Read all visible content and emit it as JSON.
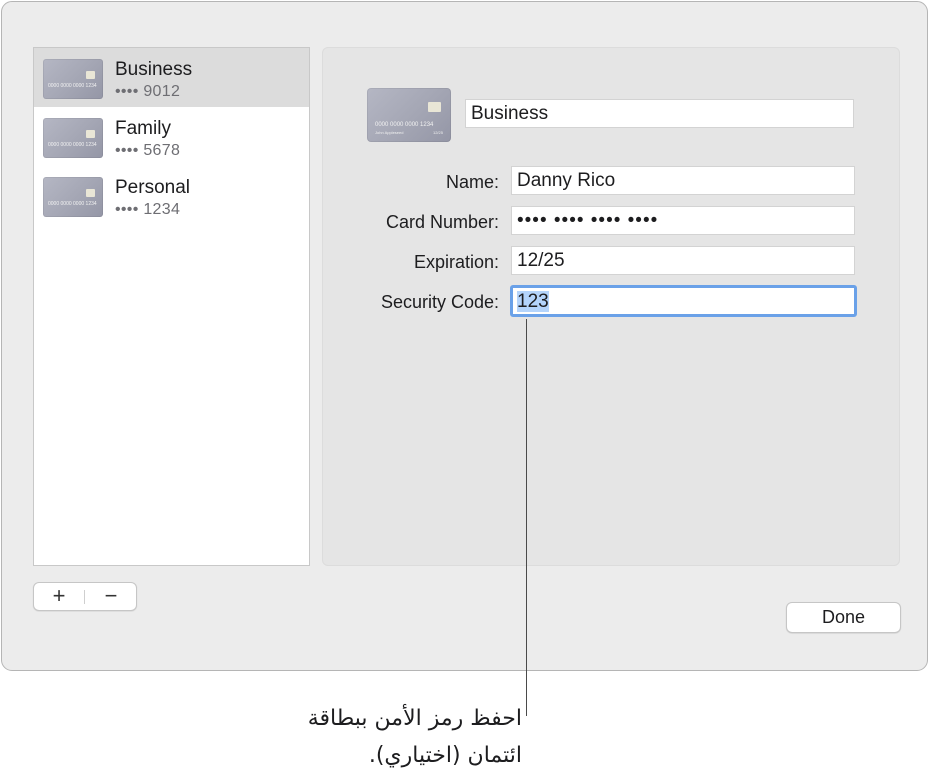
{
  "cards": [
    {
      "name": "Business",
      "digits": "•••• 9012",
      "selected": true
    },
    {
      "name": "Family",
      "digits": "•••• 5678",
      "selected": false
    },
    {
      "name": "Personal",
      "digits": "•••• 1234",
      "selected": false
    }
  ],
  "thumbnail": {
    "number": "0000 0000 0000 1234",
    "holder": "John Appleseed",
    "expiry": "12/25"
  },
  "list_controls": {
    "add_label": "+",
    "remove_label": "−"
  },
  "detail": {
    "card_title": "Business",
    "name_label": "Name:",
    "name_value": "Danny Rico",
    "number_label": "Card Number:",
    "number_value": "•••• •••• •••• ••••",
    "expiration_label": "Expiration:",
    "expiration_value": "12/25",
    "security_label": "Security Code:",
    "security_value": "123"
  },
  "done_label": "Done",
  "callout": {
    "line1": "احفظ رمز الأمن ببطاقة",
    "line2": "ائتمان (اختياري)."
  },
  "colors": {
    "focus_ring": "#6aa1e8",
    "text_selection": "#b4d4fb",
    "selected_row": "#dcdcdc"
  }
}
